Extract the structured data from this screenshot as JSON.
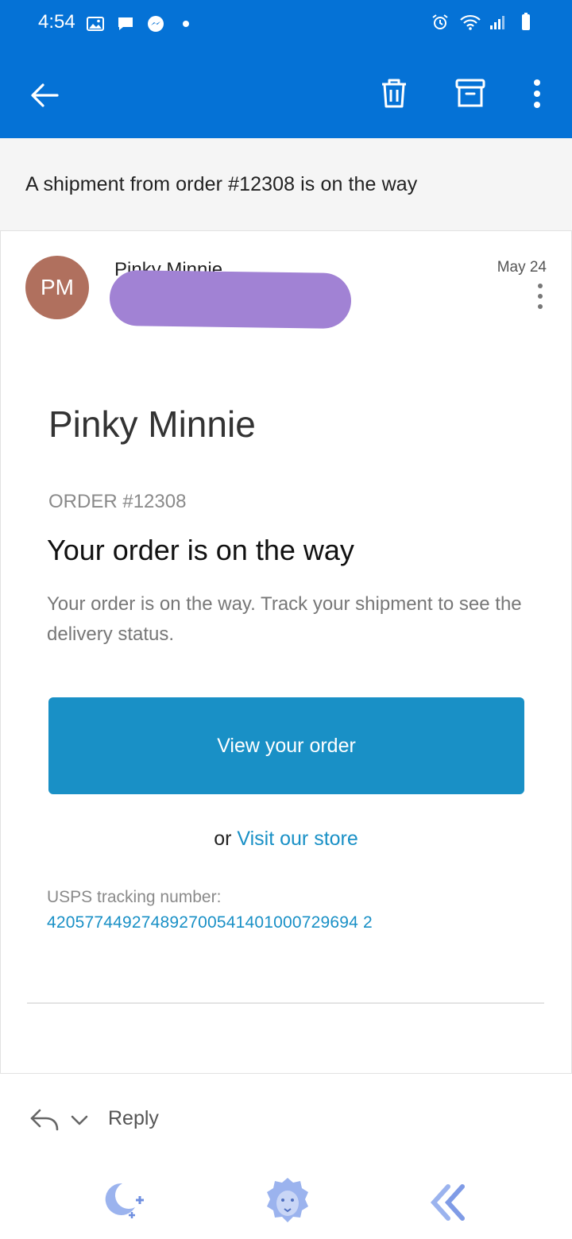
{
  "status_bar": {
    "time": "4:54",
    "left_icons": [
      "image-icon",
      "chat-icon",
      "messenger-icon",
      "dot-icon"
    ],
    "right_icons": [
      "alarm-icon",
      "wifi-icon",
      "signal-icon",
      "battery-icon"
    ]
  },
  "app_bar": {
    "icons": [
      "back-arrow-icon",
      "trash-icon",
      "archive-icon",
      "more-vert-icon"
    ],
    "color": "#0572d6"
  },
  "subject": "A shipment from order #12308 is on the way",
  "message": {
    "avatar_initials": "PM",
    "sender_name": "Pinky Minnie",
    "date": "May 24",
    "avatar_color": "#b0705e"
  },
  "email_body": {
    "shop_name": "Pinky Minnie",
    "order_label": "ORDER #12308",
    "headline": "Your order is on the way",
    "text": "Your order is on the way. Track your shipment to see the delivery status.",
    "button_label": "View your order",
    "or_text": "or",
    "store_link": "Visit our store",
    "tracking_label": "USPS tracking number:",
    "tracking_number": "420577449274892700541401000729694 2",
    "accent": "#1990c6"
  },
  "reply_bar": {
    "label": "Reply"
  },
  "bottom_nav": {
    "icons": [
      "moon-stars-icon",
      "lion-icon",
      "double-chevron-left-icon"
    ]
  }
}
